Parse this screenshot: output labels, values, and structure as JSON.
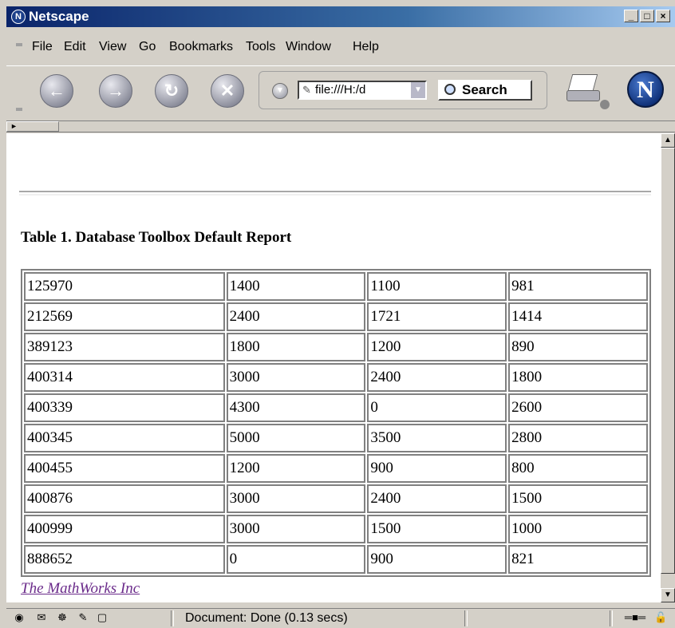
{
  "window": {
    "title": "Netscape"
  },
  "menu": [
    "File",
    "Edit",
    "View",
    "Go",
    "Bookmarks",
    "Tools",
    "Window",
    "Help"
  ],
  "toolbar": {
    "url_value": "file:///H:/d",
    "search_label": "Search"
  },
  "content": {
    "caption": "Table 1. Database Toolbox Default Report",
    "rows": [
      [
        "125970",
        "1400",
        "1100",
        "981"
      ],
      [
        "212569",
        "2400",
        "1721",
        "1414"
      ],
      [
        "389123",
        "1800",
        "1200",
        "890"
      ],
      [
        "400314",
        "3000",
        "2400",
        "1800"
      ],
      [
        "400339",
        "4300",
        "0",
        "2600"
      ],
      [
        "400345",
        "5000",
        "3500",
        "2800"
      ],
      [
        "400455",
        "1200",
        "900",
        "800"
      ],
      [
        "400876",
        "3000",
        "2400",
        "1500"
      ],
      [
        "400999",
        "3000",
        "1500",
        "1000"
      ],
      [
        "888652",
        "0",
        "900",
        "821"
      ]
    ],
    "footer_link": "The MathWorks Inc"
  },
  "status": {
    "text": "Document: Done (0.13 secs)"
  },
  "icons": {
    "back": "back-arrow-icon",
    "forward": "forward-arrow-icon",
    "reload": "reload-icon",
    "stop": "stop-icon",
    "print": "print-icon",
    "logo": "netscape-n-logo-icon"
  }
}
